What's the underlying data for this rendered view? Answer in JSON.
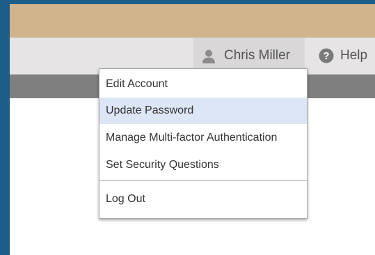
{
  "header": {
    "user_name": "Chris Miller",
    "user_icon": "user-icon",
    "help_label": "Help",
    "help_icon": "question-circle-icon"
  },
  "account_menu": {
    "items": [
      {
        "label": "Edit Account",
        "highlighted": false
      },
      {
        "label": "Update Password",
        "highlighted": true
      },
      {
        "label": "Manage Multi-factor Authentication",
        "highlighted": false
      },
      {
        "label": "Set Security Questions",
        "highlighted": false
      },
      {
        "label": "Log Out",
        "highlighted": false
      }
    ]
  },
  "colors": {
    "banner": "#d2b48c",
    "nav_bar": "#e6e4e4",
    "grey_band": "#7f7f7f",
    "highlight": "#dde6f6",
    "frame": "#1c5d8a"
  }
}
